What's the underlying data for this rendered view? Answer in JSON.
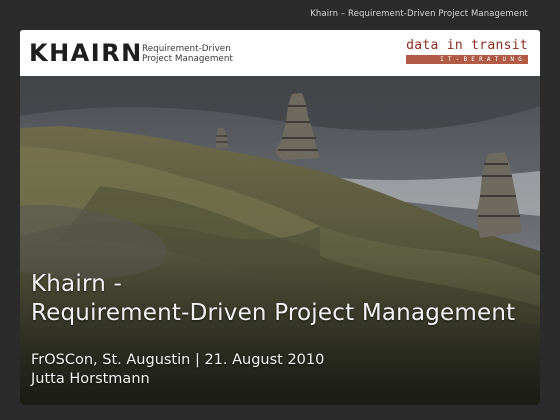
{
  "window": {
    "title": "Khairn – Requirement-Driven Project Management"
  },
  "header": {
    "logo_text": "KHAIRN",
    "logo_sub_line1": "Requirement-Driven",
    "logo_sub_line2": "Project Management",
    "brand_name": "data in transit",
    "brand_tagline": "IT-BERATUNG"
  },
  "slide": {
    "title_line1": "Khairn -",
    "title_line2": "Requirement-Driven Project Management",
    "event_line": "FrOSCon, St. Augustin | 21. August 2010",
    "author": "Jutta Horstmann"
  },
  "colors": {
    "background": "#2b2b2b",
    "brand_red": "#8a2f22",
    "brand_tag": "#b15a45"
  }
}
